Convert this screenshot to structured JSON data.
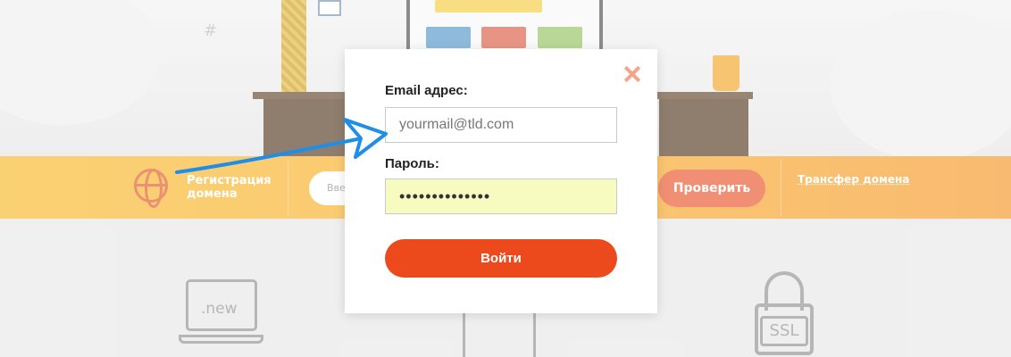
{
  "background": {
    "hero_hash": "#",
    "domain_registration_label": "Регистрация домена",
    "domain_input_partial": "Вве",
    "check_button_label": "Проверить",
    "transfer_label": "Трансфер домена",
    "feature_laptop_text": ".new",
    "feature_lock_text": "SSL"
  },
  "modal": {
    "email_label": "Email адрес:",
    "email_placeholder": "yourmail@tld.com",
    "password_label": "Пароль:",
    "password_value": "••••••••••••••",
    "login_button_label": "Войти",
    "close_icon": "close-icon"
  },
  "colors": {
    "accent": "#ec4a1d",
    "band": "#f9a51a",
    "close": "#f3a58a",
    "password_bg": "#f8fbc0",
    "arrow": "#1e8ee8"
  }
}
